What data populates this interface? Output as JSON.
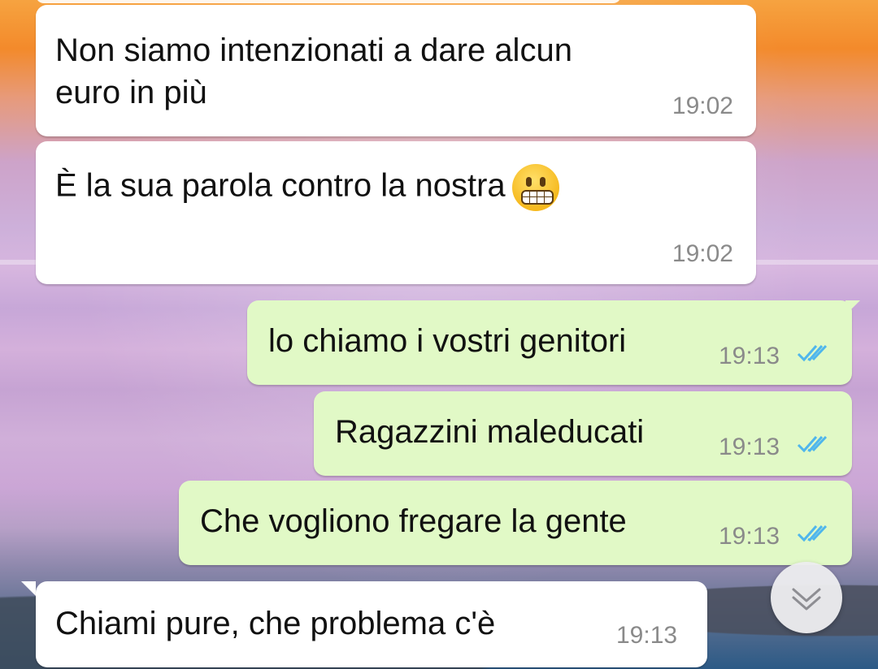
{
  "chat": {
    "messages": [
      {
        "direction": "incoming",
        "text_lines": [
          "Non siamo intenzionati a dare alcun",
          "euro in più"
        ],
        "time": "19:02"
      },
      {
        "direction": "incoming",
        "text": "È la sua parola contro la nostra",
        "emoji": "grimacing-face-emoji",
        "time": "19:02"
      },
      {
        "direction": "outgoing",
        "text": "lo chiamo i vostri genitori",
        "time": "19:13",
        "status": "read-double-check"
      },
      {
        "direction": "outgoing",
        "text": "Ragazzini maleducati",
        "time": "19:13",
        "status": "read-double-check"
      },
      {
        "direction": "outgoing",
        "text": "Che vogliono fregare la gente",
        "time": "19:13",
        "status": "read-double-check"
      },
      {
        "direction": "incoming",
        "text": "Chiami pure, che problema c'è",
        "time": "19:13"
      }
    ]
  },
  "scroll_button": {
    "icon": "chevron-double-down-icon"
  },
  "colors": {
    "incoming_bubble": "#ffffff",
    "outgoing_bubble": "#e1f9c6",
    "timestamp": "#8a8a8a",
    "read_ticks": "#4fb6ec"
  }
}
